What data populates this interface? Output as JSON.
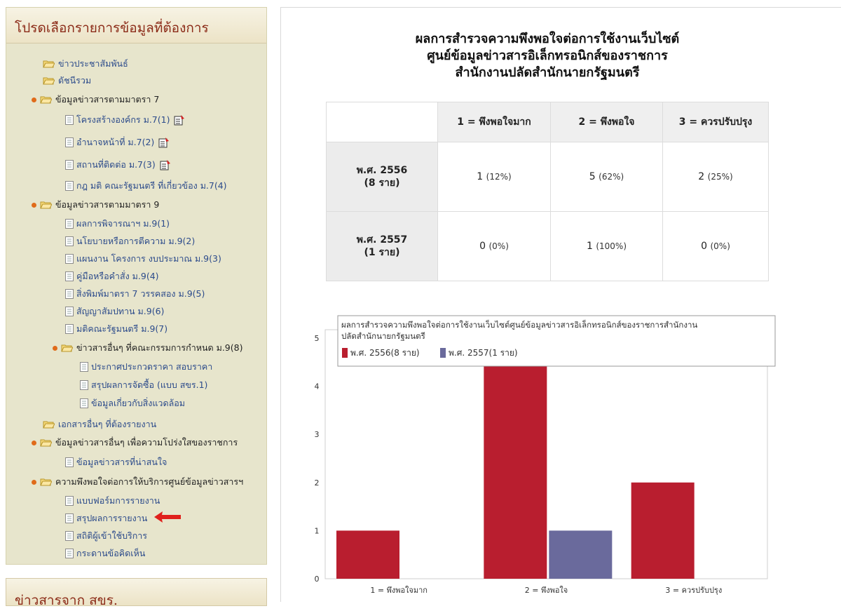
{
  "sidebar": {
    "title": "โปรดเลือกรายการข้อมูลที่ต้องการ",
    "items": [
      {
        "label": "ข่าวประชาสัมพันธ์"
      },
      {
        "label": "ดัชนีรวม"
      },
      {
        "label": "ข้อมูลข่าวสารตามมาตรา 7"
      },
      {
        "label": "โครงสร้างองค์กร ม.7(1)"
      },
      {
        "label": "อำนาจหน้าที่ ม.7(2)"
      },
      {
        "label": "สถานที่ติดต่อ ม.7(3)"
      },
      {
        "label": "กฎ มติ คณะรัฐมนตรี ที่เกี่ยวข้อง ม.7(4)"
      },
      {
        "label": "ข้อมูลข่าวสารตามมาตรา 9"
      },
      {
        "label": "ผลการพิจารณาฯ ม.9(1)"
      },
      {
        "label": "นโยบายหรือการตีความ ม.9(2)"
      },
      {
        "label": "แผนงาน โครงการ งบประมาณ ม.9(3)"
      },
      {
        "label": "คู่มือหรือคำสั่ง ม.9(4)"
      },
      {
        "label": "สิ่งพิมพ์มาตรา 7 วรรคสอง ม.9(5)"
      },
      {
        "label": "สัญญาสัมปทาน ม.9(6)"
      },
      {
        "label": "มติคณะรัฐมนตรี ม.9(7)"
      },
      {
        "label": "ข่าวสารอื่นๆ ที่คณะกรรมการกำหนด ม.9(8)"
      },
      {
        "label": "ประกาศประกวดราคา สอบราคา"
      },
      {
        "label": "สรุปผลการจัดซื้อ (แบบ สขร.1)"
      },
      {
        "label": "ข้อมูลเกี่ยวกับสิ่งแวดล้อม"
      },
      {
        "label": "เอกสารอื่นๆ ที่ต้องรายงาน"
      },
      {
        "label": "ข้อมูลข่าวสารอื่นๆ เพื่อความโปร่งใสของราชการ"
      },
      {
        "label": "ข้อมูลข่าวสารที่น่าสนใจ"
      },
      {
        "label": "ความพึงพอใจต่อการให้บริการศูนย์ข้อมูลข่าวสารฯ"
      },
      {
        "label": "แบบฟอร์มการรายงาน"
      },
      {
        "label": "สรุปผลการรายงาน"
      },
      {
        "label": "สถิติผู้เข้าใช้บริการ"
      },
      {
        "label": "กระดานข้อคิดเห็น"
      }
    ]
  },
  "sidebar2": {
    "title": "ข่าวสารจาก สขร."
  },
  "main": {
    "title_lines": [
      "ผลการสำรวจความพึงพอใจต่อการใช้งานเว็บไซต์",
      "ศูนย์ข้อมูลข่าวสารอิเล็กทรอนิกส์ของราชการ",
      "สำนักงานปลัดสำนักนายกรัฐมนตรี"
    ],
    "table": {
      "headers": [
        "1 = พึงพอใจมาก",
        "2 = พึงพอใจ",
        "3 = ควรปรับปรุง"
      ],
      "rows": [
        {
          "label_line1": "พ.ศ. 2556",
          "label_line2": "(8 ราย)",
          "cells": [
            {
              "n": "1",
              "p": "(12%)"
            },
            {
              "n": "5",
              "p": "(62%)"
            },
            {
              "n": "2",
              "p": "(25%)"
            }
          ]
        },
        {
          "label_line1": "พ.ศ. 2557",
          "label_line2": "(1 ราย)",
          "cells": [
            {
              "n": "0",
              "p": "(0%)"
            },
            {
              "n": "1",
              "p": "(100%)"
            },
            {
              "n": "0",
              "p": "(0%)"
            }
          ]
        }
      ]
    }
  },
  "chart_data": {
    "type": "bar",
    "title_line1": "ผลการสำรวจความพึงพอใจต่อการใช้งานเว็บไซต์ศูนย์ข้อมูลข่าวสารอิเล็กทรอนิกส์ของราชการสำนักงาน",
    "title_line2": "ปลัดสำนักนายกรัฐมนตรี",
    "categories": [
      "1 = พึงพอใจมาก",
      "2 = พึงพอใจ",
      "3 = ควรปรับปรุง"
    ],
    "series": [
      {
        "name": "พ.ศ. 2556(8 ราย)",
        "values": [
          1,
          5,
          2
        ],
        "color": "#b91e2f"
      },
      {
        "name": "พ.ศ. 2557(1 ราย)",
        "values": [
          0,
          1,
          0
        ],
        "color": "#6a6a9c"
      }
    ],
    "ylim": [
      0,
      5
    ],
    "yticks": [
      "0",
      "1",
      "2",
      "3",
      "4",
      "5"
    ],
    "legend_position": "top",
    "grid": false
  }
}
